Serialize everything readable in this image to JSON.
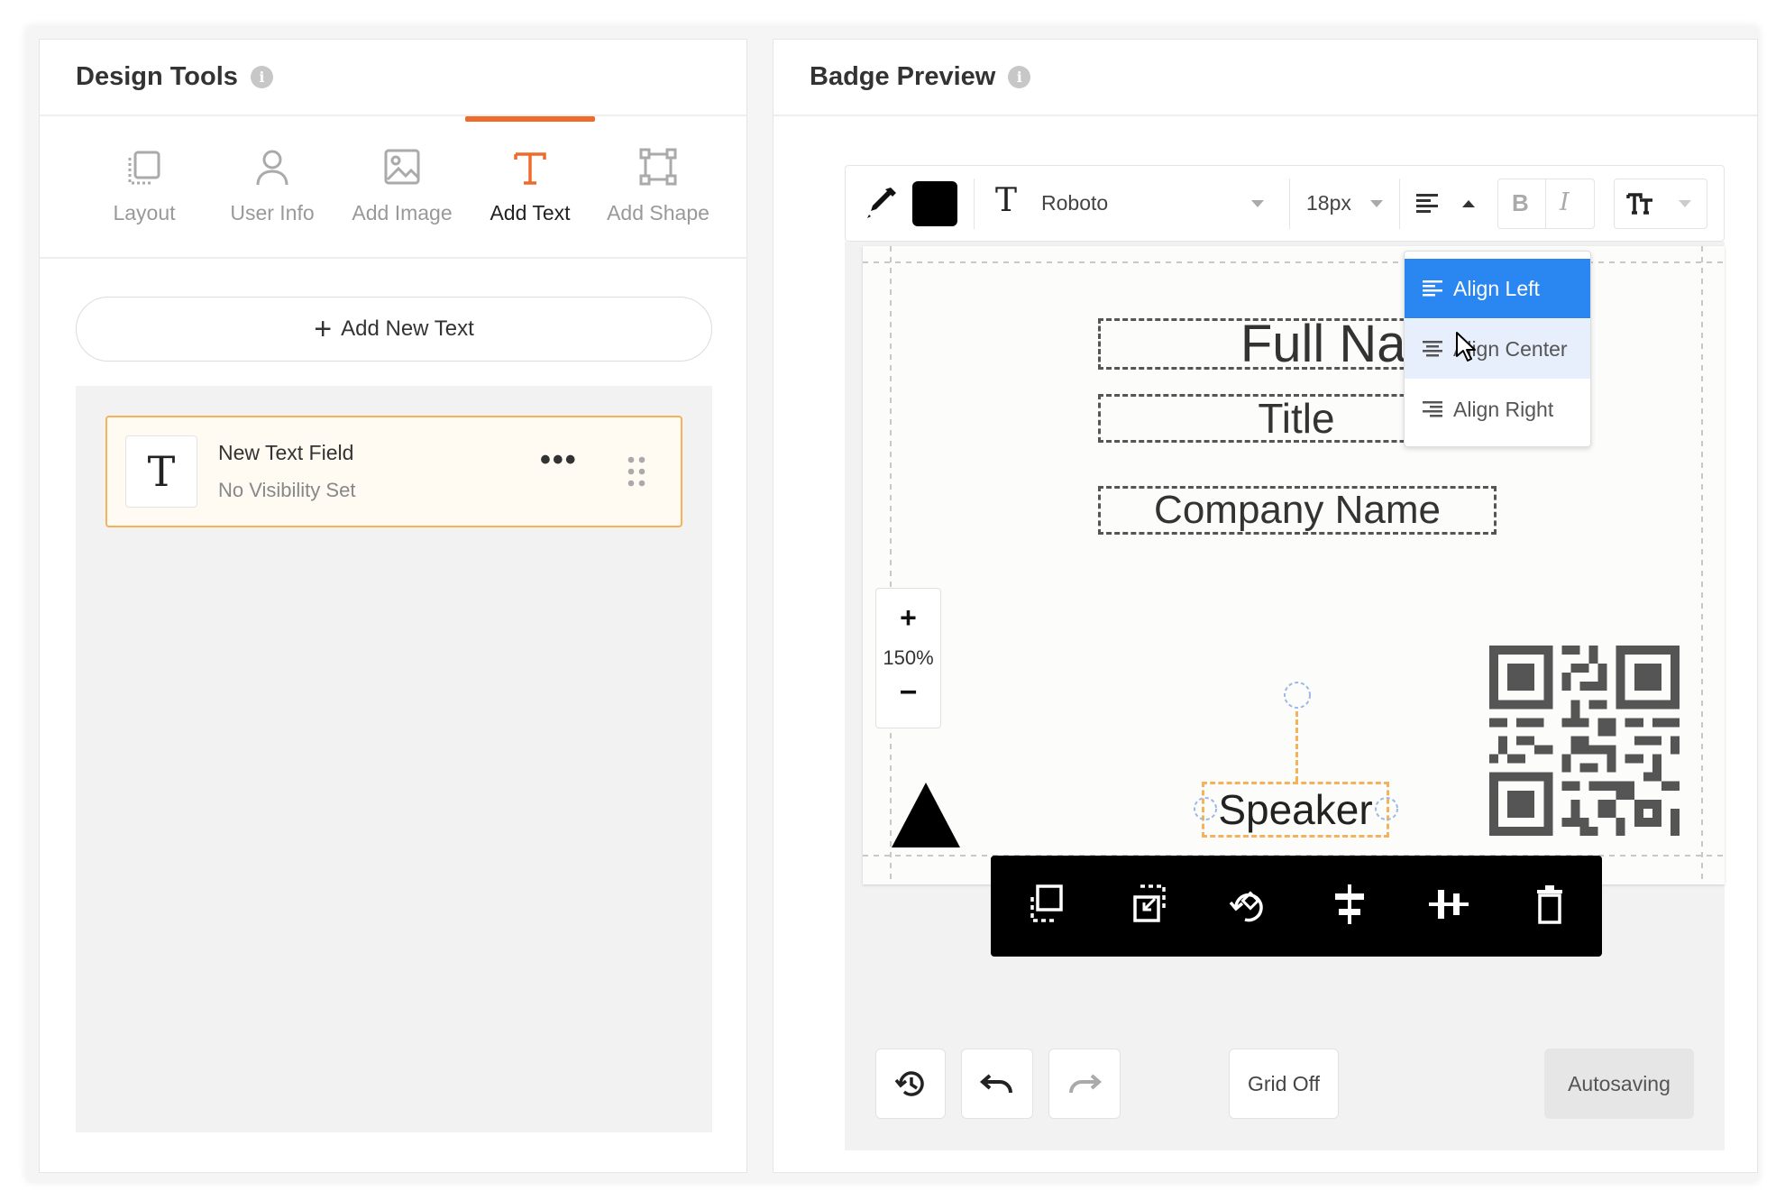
{
  "left_panel": {
    "title": "Design Tools",
    "info_icon": "i",
    "tabs": [
      {
        "label": "Layout",
        "icon": "layout-icon",
        "active": false
      },
      {
        "label": "User Info",
        "icon": "user-icon",
        "active": false
      },
      {
        "label": "Add Image",
        "icon": "image-icon",
        "active": false
      },
      {
        "label": "Add Text",
        "icon": "text-icon",
        "active": true
      },
      {
        "label": "Add Shape",
        "icon": "shape-icon",
        "active": false
      }
    ],
    "add_button": {
      "plus": "+",
      "label": "Add New Text"
    },
    "text_items": [
      {
        "icon_glyph": "T",
        "title": "New Text Field",
        "subtitle": "No Visibility Set",
        "menu": "•••"
      }
    ]
  },
  "right_panel": {
    "title": "Badge Preview",
    "info_icon": "i",
    "toolbar": {
      "text_color": "#000000",
      "font_icon_glyph": "T",
      "font": "Roboto",
      "size": "18px",
      "bold": "B",
      "italic": "I"
    },
    "align_menu": {
      "items": [
        {
          "label": "Align Left",
          "state": "selected"
        },
        {
          "label": "Align Center",
          "state": "hover"
        },
        {
          "label": "Align Right",
          "state": "normal"
        }
      ]
    },
    "badge": {
      "full_name": "Full Name",
      "title": "Title",
      "company": "Company Name",
      "role": "Speaker"
    },
    "zoom": {
      "plus": "+",
      "level": "150%",
      "minus": "−"
    },
    "bottom": {
      "grid_label": "Grid Off",
      "status": "Autosaving"
    }
  },
  "colors": {
    "accent": "#ef6b2c",
    "selection_border": "#f6b25b",
    "menu_selected": "#2a86f0",
    "menu_hover": "#e7eefc",
    "context_bar": "#000000"
  }
}
